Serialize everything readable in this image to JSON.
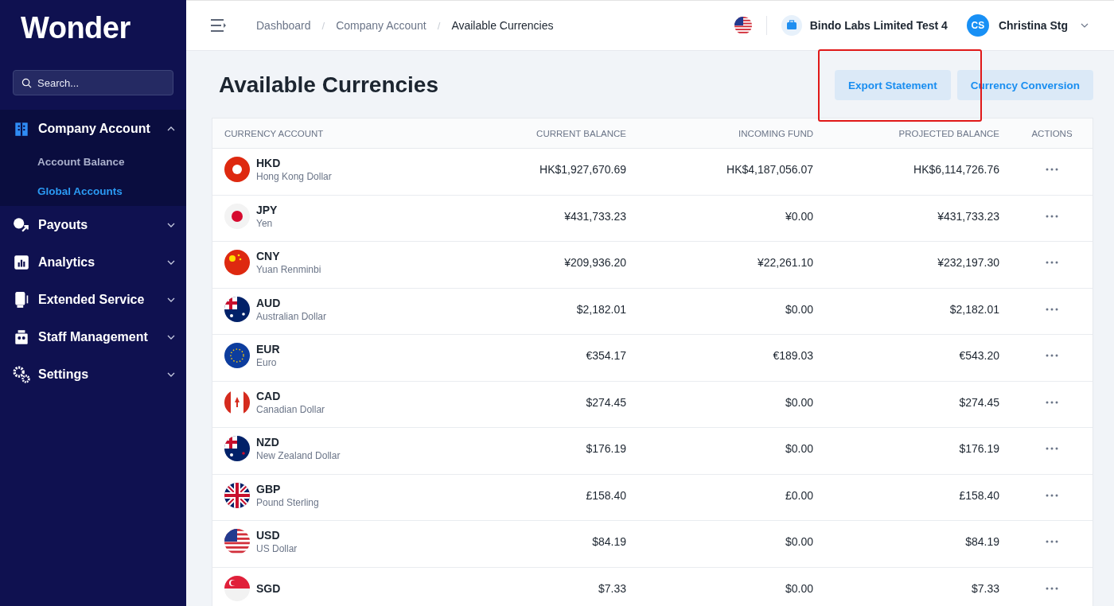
{
  "brand": "Wonder",
  "search": {
    "placeholder": "Search..."
  },
  "nav": [
    {
      "label": "Company Account",
      "kind": "building",
      "expanded": true,
      "children": [
        {
          "label": "Account Balance",
          "selected": false
        },
        {
          "label": "Global Accounts",
          "selected": true
        }
      ]
    },
    {
      "label": "Payouts",
      "kind": "payout",
      "expanded": false
    },
    {
      "label": "Analytics",
      "kind": "chart",
      "expanded": false
    },
    {
      "label": "Extended Service",
      "kind": "terminal",
      "expanded": false
    },
    {
      "label": "Staff Management",
      "kind": "staff",
      "expanded": false
    },
    {
      "label": "Settings",
      "kind": "gears",
      "expanded": false
    }
  ],
  "breadcrumbs": [
    "Dashboard",
    "Company Account",
    "Available Currencies"
  ],
  "breadcrumb_separator": "/",
  "company": "Bindo Labs Limited Test 4",
  "user": {
    "initials": "CS",
    "name": "Christina Stg"
  },
  "page_title": "Available Currencies",
  "buttons": [
    "Export Statement",
    "Currency Conversion"
  ],
  "table": {
    "columns": [
      "CURRENCY ACCOUNT",
      "CURRENT BALANCE",
      "INCOMING FUND",
      "PROJECTED BALANCE",
      "ACTIONS"
    ],
    "rows": [
      {
        "kind": "hk",
        "code": "HKD",
        "name": "Hong Kong Dollar",
        "current": "HK$1,927,670.69",
        "incoming": "HK$4,187,056.07",
        "projected": "HK$6,114,726.76"
      },
      {
        "kind": "jp",
        "code": "JPY",
        "name": "Yen",
        "current": "¥431,733.23",
        "incoming": "¥0.00",
        "projected": "¥431,733.23"
      },
      {
        "kind": "cn",
        "code": "CNY",
        "name": "Yuan Renminbi",
        "current": "¥209,936.20",
        "incoming": "¥22,261.10",
        "projected": "¥232,197.30"
      },
      {
        "kind": "au",
        "code": "AUD",
        "name": "Australian Dollar",
        "current": "$2,182.01",
        "incoming": "$0.00",
        "projected": "$2,182.01"
      },
      {
        "kind": "eu",
        "code": "EUR",
        "name": "Euro",
        "current": "€354.17",
        "incoming": "€189.03",
        "projected": "€543.20"
      },
      {
        "kind": "ca",
        "code": "CAD",
        "name": "Canadian Dollar",
        "current": "$274.45",
        "incoming": "$0.00",
        "projected": "$274.45"
      },
      {
        "kind": "nz",
        "code": "NZD",
        "name": "New Zealand Dollar",
        "current": "$176.19",
        "incoming": "$0.00",
        "projected": "$176.19"
      },
      {
        "kind": "gb",
        "code": "GBP",
        "name": "Pound Sterling",
        "current": "£158.40",
        "incoming": "£0.00",
        "projected": "£158.40"
      },
      {
        "kind": "us",
        "code": "USD",
        "name": "US Dollar",
        "current": "$84.19",
        "incoming": "$0.00",
        "projected": "$84.19"
      },
      {
        "kind": "sg",
        "code": "SGD",
        "current": "$7.33",
        "incoming": "$0.00",
        "projected": "$7.33"
      }
    ]
  }
}
